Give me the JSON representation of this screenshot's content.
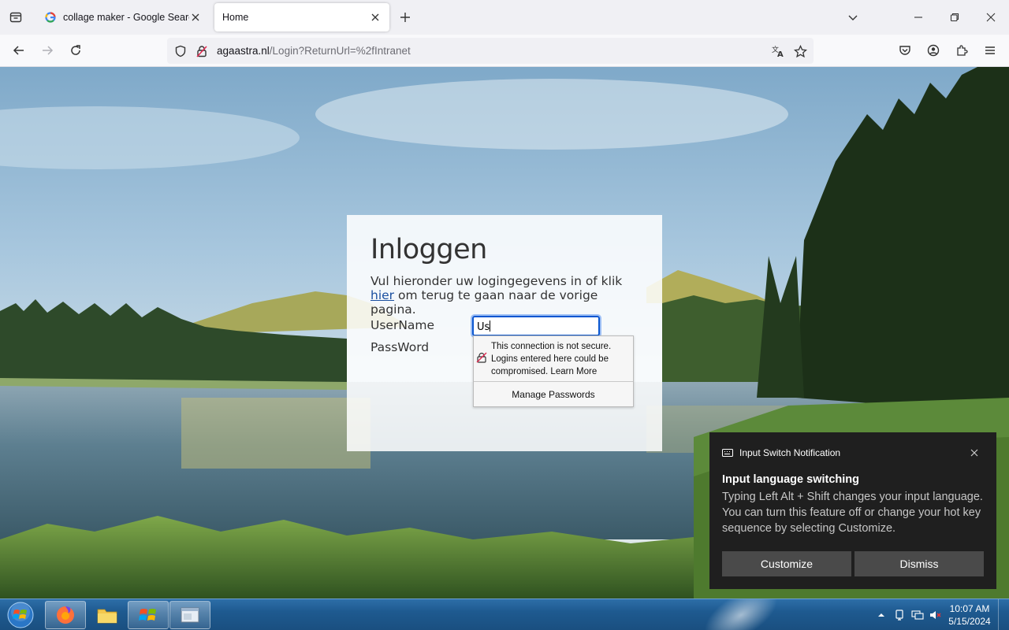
{
  "browser": {
    "tabs": [
      {
        "title": "collage maker - Google Search",
        "favicon": "google-g-icon",
        "active": false
      },
      {
        "title": "Home",
        "favicon": "",
        "active": true
      }
    ],
    "url": {
      "domain": "agaastra.nl",
      "path": "/Login?ReturnUrl=%2fIntranet"
    }
  },
  "login": {
    "heading": "Inloggen",
    "intro_before": "Vul hieronder uw logingegevens in of klik ",
    "intro_link": "hier",
    "intro_after": " om terug te gaan naar de vorige pagina.",
    "username_label": "UserName",
    "password_label": "PassWord",
    "username_value": "Us"
  },
  "password_popup": {
    "warning_text": "This connection is not secure. Logins entered here could be compromised.",
    "learn_more": "Learn More",
    "manage_label": "Manage Passwords"
  },
  "notification": {
    "app_name": "Input Switch Notification",
    "title": "Input language switching",
    "body": "Typing Left Alt + Shift changes your input language. You can turn this feature off or change your hot key sequence by selecting Customize.",
    "customize_label": "Customize",
    "dismiss_label": "Dismiss"
  },
  "taskbar": {
    "items": [
      "firefox-icon",
      "file-explorer-icon",
      "windows-flag-icon",
      "window-app-icon"
    ],
    "time": "10:07 AM",
    "date": "5/15/2024"
  },
  "colors": {
    "link": "#1a4fa0",
    "focus_border": "#0b57d0",
    "toast_bg": "#1f1f1f",
    "taskbar": "#1e5a90"
  }
}
